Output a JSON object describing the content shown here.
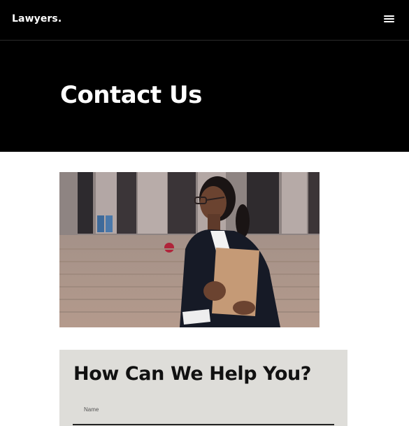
{
  "header": {
    "logo": "Lawyers.",
    "menu_icon": "hamburger-menu-icon"
  },
  "hero": {
    "title": "Contact Us"
  },
  "photo": {
    "subject": "lawyer-portrait-image"
  },
  "help": {
    "title": "How Can We Help You?",
    "name_label": "Name"
  },
  "colors": {
    "header_bg": "#000000",
    "panel_bg": "#deddd9",
    "text_light": "#ffffff",
    "text_dark": "#111111"
  }
}
